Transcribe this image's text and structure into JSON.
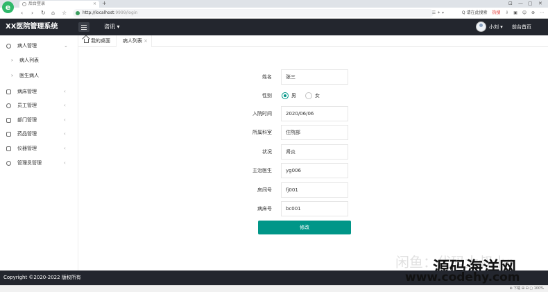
{
  "browser": {
    "logo": "e",
    "tab_title": "后台登录",
    "tab_close": "×",
    "new_tab": "+",
    "url_host": "http://localhost",
    "url_rest": ":9999/login",
    "url_right": "☰ ✦ ▾",
    "search_hint": "Q 请在此搜索",
    "hot_label": "热搜",
    "win_controls": [
      "⊡",
      "—",
      "▢",
      "✕"
    ],
    "tools": [
      "⇩",
      "▣",
      "☺",
      "⊕",
      "⋯"
    ]
  },
  "header": {
    "title": "XX医院管理系统",
    "menu_label": "咨讯 ▾",
    "user_name": "小刘 ▾",
    "front_link": "前台首页"
  },
  "sidebar": {
    "items": [
      {
        "label": "病人管理",
        "icon": "user-icon",
        "arrow": "⌄"
      },
      {
        "label": "病床管理",
        "icon": "bed-icon",
        "arrow": "‹"
      },
      {
        "label": "员工管理",
        "icon": "staff-icon",
        "arrow": "‹"
      },
      {
        "label": "部门管理",
        "icon": "department-icon",
        "arrow": "‹"
      },
      {
        "label": "药品管理",
        "icon": "medicine-icon",
        "arrow": "‹"
      },
      {
        "label": "仪器管理",
        "icon": "instrument-icon",
        "arrow": "‹"
      },
      {
        "label": "管理员管理",
        "icon": "admin-icon",
        "arrow": "‹"
      }
    ],
    "sub_items": [
      {
        "label": "病人列表",
        "arrow": "›"
      },
      {
        "label": "医生病人",
        "arrow": "›"
      }
    ]
  },
  "tabs": {
    "home_label": "我的桌面",
    "active_label": "病人列表",
    "close": "×"
  },
  "form": {
    "name_label": "姓名",
    "name_value": "张三",
    "gender_label": "性别",
    "gender_male": "男",
    "gender_female": "女",
    "admit_label": "入院时间",
    "admit_value": "2020/06/06",
    "disease_label": "所属科室",
    "disease_value": "住院部",
    "status_label": "状况",
    "status_value": "肾炎",
    "doctor_label": "主治医生",
    "doctor_value": "yg006",
    "room_label": "房间号",
    "room_value": "fj001",
    "bed_label": "病床号",
    "bed_value": "bc001",
    "submit_label": "修改"
  },
  "footer": {
    "copyright": "Copyright ©2020-2022 版权所有",
    "status_text": "⊕ 下载 ⊞ ⊟ ▢ 100%"
  },
  "watermark": {
    "faint": "闲鱼：代码大叔小r",
    "main": "源码海洋网",
    "url": "www.codehy.com"
  },
  "colors": {
    "header_bg": "#23262e",
    "accent": "#009688"
  }
}
